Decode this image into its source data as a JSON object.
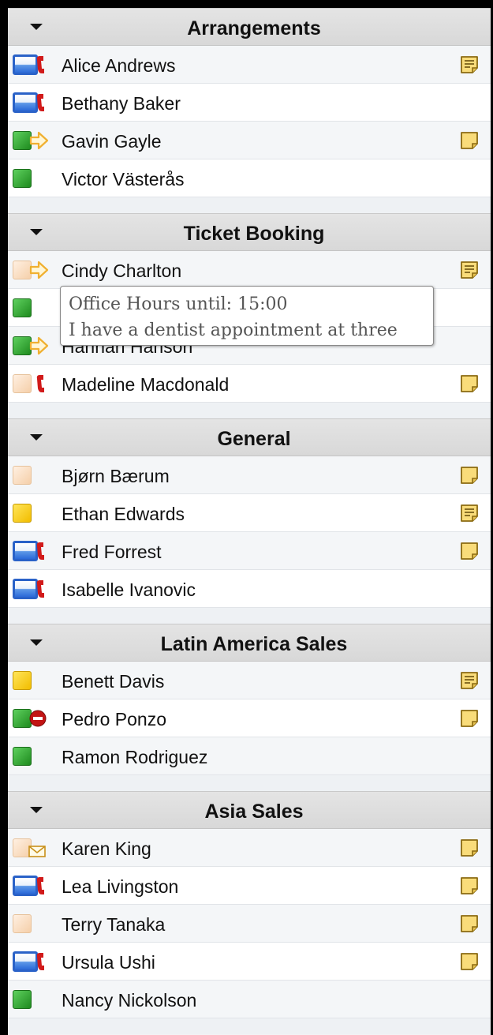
{
  "colors": {
    "background": "#000000",
    "panel": "#f2f3f5",
    "header": "#dcdcdc",
    "available": "#2fae2f",
    "away": "#f7cf10",
    "offline": "#f5d8bb",
    "phone": "#2a62c8",
    "phone_handset": "#d11a1a",
    "forward_arrow": "#f0b030",
    "note": "#f7d77a",
    "blocked": "#c21414"
  },
  "groups": [
    {
      "title": "Arrangements",
      "contacts": [
        {
          "name": "Alice Andrews",
          "status": "phone",
          "badge": "phone-handset",
          "note": "lined"
        },
        {
          "name": "Bethany Baker",
          "status": "phone",
          "badge": "phone-handset",
          "note": ""
        },
        {
          "name": "Gavin Gayle",
          "status": "green",
          "badge": "forward-arrow",
          "note": "blank"
        },
        {
          "name": "Victor Västerås",
          "status": "green",
          "badge": "",
          "note": ""
        }
      ]
    },
    {
      "title": "Ticket Booking",
      "contacts": [
        {
          "name": "Cindy Charlton",
          "status": "peach",
          "badge": "forward-arrow",
          "note": "lined"
        },
        {
          "name": "",
          "status": "green",
          "badge": "",
          "note": ""
        },
        {
          "name": "Hannah Hanson",
          "status": "green",
          "badge": "forward-arrow",
          "note": ""
        },
        {
          "name": "Madeline Macdonald",
          "status": "peach",
          "badge": "phone-handset",
          "note": "blank"
        }
      ]
    },
    {
      "title": "General",
      "contacts": [
        {
          "name": "Bjørn Bærum",
          "status": "peach",
          "badge": "",
          "note": "blank"
        },
        {
          "name": "Ethan Edwards",
          "status": "yellow",
          "badge": "",
          "note": "lined"
        },
        {
          "name": "Fred Forrest",
          "status": "phone",
          "badge": "phone-handset",
          "note": "blank"
        },
        {
          "name": "Isabelle Ivanovic",
          "status": "phone",
          "badge": "phone-handset",
          "note": ""
        }
      ]
    },
    {
      "title": "Latin America Sales",
      "contacts": [
        {
          "name": "Benett Davis",
          "status": "yellow",
          "badge": "",
          "note": "lined"
        },
        {
          "name": "Pedro Ponzo",
          "status": "green",
          "badge": "blocked",
          "note": "blank"
        },
        {
          "name": "Ramon Rodriguez",
          "status": "green",
          "badge": "",
          "note": ""
        }
      ]
    },
    {
      "title": "Asia Sales",
      "contacts": [
        {
          "name": "Karen King",
          "status": "peach",
          "badge": "envelope",
          "note": "blank"
        },
        {
          "name": "Lea Livingston",
          "status": "phone",
          "badge": "phone-handset",
          "note": "blank"
        },
        {
          "name": "Terry Tanaka",
          "status": "peach",
          "badge": "",
          "note": "blank"
        },
        {
          "name": "Ursula Ushi",
          "status": "phone",
          "badge": "phone-handset",
          "note": "blank"
        },
        {
          "name": "Nancy Nickolson",
          "status": "green",
          "badge": "",
          "note": ""
        }
      ]
    }
  ],
  "tooltip": {
    "line1": "Office Hours until: 15:00",
    "line2": "I have a dentist appointment at three"
  }
}
